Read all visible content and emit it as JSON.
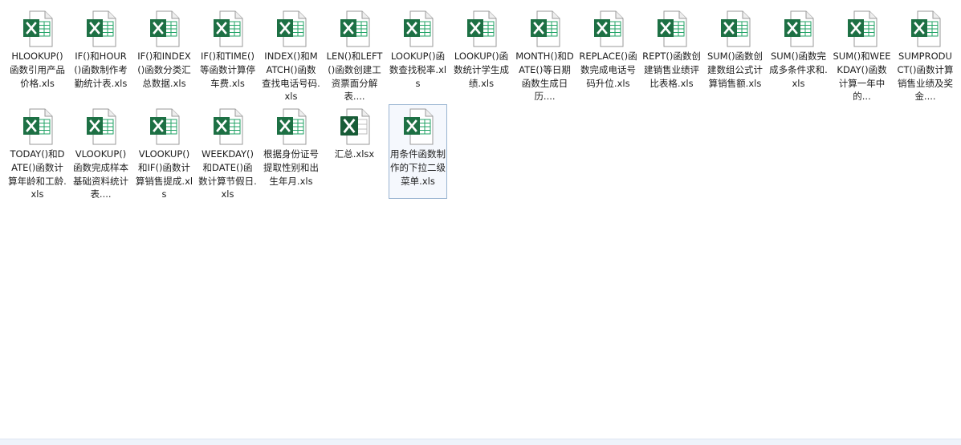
{
  "colors": {
    "excel_green": "#1d7044",
    "excel_green_dark": "#185c37",
    "excel_grid_fill": "#21a366",
    "selected_border": "#99b4d1"
  },
  "files": [
    {
      "name": "HLOOKUP()函数引用产品价格.xls",
      "type": "xls",
      "icon": "excel-xls-icon"
    },
    {
      "name": "IF()和HOUR()函数制作考勤统计表.xls",
      "type": "xls",
      "icon": "excel-xls-icon"
    },
    {
      "name": "IF()和INDEX()函数分类汇总数据.xls",
      "type": "xls",
      "icon": "excel-xls-icon"
    },
    {
      "name": "IF()和TIME()等函数计算停车费.xls",
      "type": "xls",
      "icon": "excel-xls-icon"
    },
    {
      "name": "INDEX()和MATCH()函数查找电话号码.xls",
      "type": "xls",
      "icon": "excel-xls-icon"
    },
    {
      "name": "LEN()和LEFT()函数创建工资票面分解表....",
      "type": "xls",
      "icon": "excel-xls-icon"
    },
    {
      "name": "LOOKUP()函数查找税率.xls",
      "type": "xls",
      "icon": "excel-xls-icon"
    },
    {
      "name": "LOOKUP()函数统计学生成绩.xls",
      "type": "xls",
      "icon": "excel-xls-icon"
    },
    {
      "name": "MONTH()和DATE()等日期函数生成日历....",
      "type": "xls",
      "icon": "excel-xls-icon"
    },
    {
      "name": "REPLACE()函数完成电话号码升位.xls",
      "type": "xls",
      "icon": "excel-xls-icon"
    },
    {
      "name": "REPT()函数创建销售业绩评比表格.xls",
      "type": "xls",
      "icon": "excel-xls-icon"
    },
    {
      "name": "SUM()函数创建数组公式计算销售额.xls",
      "type": "xls",
      "icon": "excel-xls-icon"
    },
    {
      "name": "SUM()函数完成多条件求和.xls",
      "type": "xls",
      "icon": "excel-xls-icon"
    },
    {
      "name": "SUM()和WEEKDAY()函数计算一年中的...",
      "type": "xls",
      "icon": "excel-xls-icon"
    },
    {
      "name": "SUMPRODUCT()函数计算销售业绩及奖金....",
      "type": "xls",
      "icon": "excel-xls-icon"
    },
    {
      "name": "TODAY()和DATE()函数计算年龄和工龄.xls",
      "type": "xls",
      "icon": "excel-xls-icon"
    },
    {
      "name": "VLOOKUP()函数完成样本基础资料统计表....",
      "type": "xls",
      "icon": "excel-xls-icon"
    },
    {
      "name": "VLOOKUP()和IF()函数计算销售提成.xls",
      "type": "xls",
      "icon": "excel-xls-icon"
    },
    {
      "name": "WEEKDAY()和DATE()函数计算节假日.xls",
      "type": "xls",
      "icon": "excel-xls-icon"
    },
    {
      "name": "根据身份证号提取性别和出生年月.xls",
      "type": "xls",
      "icon": "excel-xls-icon"
    },
    {
      "name": "汇总.xlsx",
      "type": "xlsx",
      "icon": "excel-xlsx-icon"
    },
    {
      "name": "用条件函数制作的下拉二级菜单.xls",
      "type": "xls",
      "icon": "excel-xls-icon",
      "selected": true
    }
  ]
}
